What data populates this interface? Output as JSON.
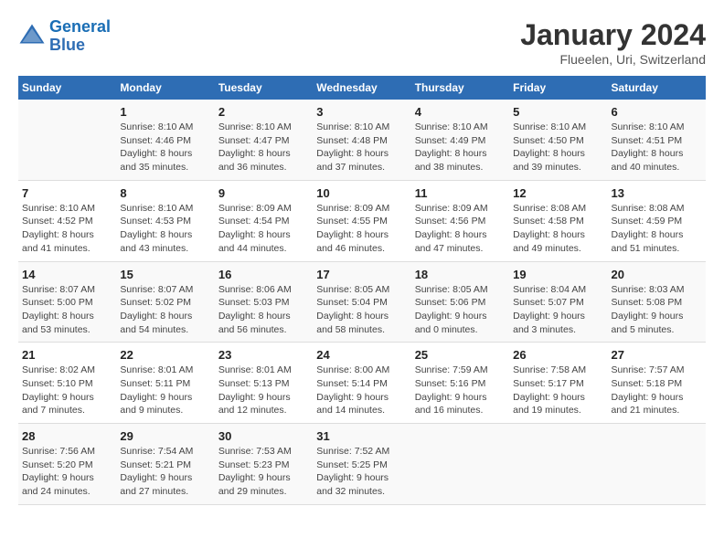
{
  "header": {
    "logo_line1": "General",
    "logo_line2": "Blue",
    "month": "January 2024",
    "location": "Flueelen, Uri, Switzerland"
  },
  "weekdays": [
    "Sunday",
    "Monday",
    "Tuesday",
    "Wednesday",
    "Thursday",
    "Friday",
    "Saturday"
  ],
  "weeks": [
    [
      {
        "day": "",
        "info": ""
      },
      {
        "day": "1",
        "info": "Sunrise: 8:10 AM\nSunset: 4:46 PM\nDaylight: 8 hours\nand 35 minutes."
      },
      {
        "day": "2",
        "info": "Sunrise: 8:10 AM\nSunset: 4:47 PM\nDaylight: 8 hours\nand 36 minutes."
      },
      {
        "day": "3",
        "info": "Sunrise: 8:10 AM\nSunset: 4:48 PM\nDaylight: 8 hours\nand 37 minutes."
      },
      {
        "day": "4",
        "info": "Sunrise: 8:10 AM\nSunset: 4:49 PM\nDaylight: 8 hours\nand 38 minutes."
      },
      {
        "day": "5",
        "info": "Sunrise: 8:10 AM\nSunset: 4:50 PM\nDaylight: 8 hours\nand 39 minutes."
      },
      {
        "day": "6",
        "info": "Sunrise: 8:10 AM\nSunset: 4:51 PM\nDaylight: 8 hours\nand 40 minutes."
      }
    ],
    [
      {
        "day": "7",
        "info": "Sunrise: 8:10 AM\nSunset: 4:52 PM\nDaylight: 8 hours\nand 41 minutes."
      },
      {
        "day": "8",
        "info": "Sunrise: 8:10 AM\nSunset: 4:53 PM\nDaylight: 8 hours\nand 43 minutes."
      },
      {
        "day": "9",
        "info": "Sunrise: 8:09 AM\nSunset: 4:54 PM\nDaylight: 8 hours\nand 44 minutes."
      },
      {
        "day": "10",
        "info": "Sunrise: 8:09 AM\nSunset: 4:55 PM\nDaylight: 8 hours\nand 46 minutes."
      },
      {
        "day": "11",
        "info": "Sunrise: 8:09 AM\nSunset: 4:56 PM\nDaylight: 8 hours\nand 47 minutes."
      },
      {
        "day": "12",
        "info": "Sunrise: 8:08 AM\nSunset: 4:58 PM\nDaylight: 8 hours\nand 49 minutes."
      },
      {
        "day": "13",
        "info": "Sunrise: 8:08 AM\nSunset: 4:59 PM\nDaylight: 8 hours\nand 51 minutes."
      }
    ],
    [
      {
        "day": "14",
        "info": "Sunrise: 8:07 AM\nSunset: 5:00 PM\nDaylight: 8 hours\nand 53 minutes."
      },
      {
        "day": "15",
        "info": "Sunrise: 8:07 AM\nSunset: 5:02 PM\nDaylight: 8 hours\nand 54 minutes."
      },
      {
        "day": "16",
        "info": "Sunrise: 8:06 AM\nSunset: 5:03 PM\nDaylight: 8 hours\nand 56 minutes."
      },
      {
        "day": "17",
        "info": "Sunrise: 8:05 AM\nSunset: 5:04 PM\nDaylight: 8 hours\nand 58 minutes."
      },
      {
        "day": "18",
        "info": "Sunrise: 8:05 AM\nSunset: 5:06 PM\nDaylight: 9 hours\nand 0 minutes."
      },
      {
        "day": "19",
        "info": "Sunrise: 8:04 AM\nSunset: 5:07 PM\nDaylight: 9 hours\nand 3 minutes."
      },
      {
        "day": "20",
        "info": "Sunrise: 8:03 AM\nSunset: 5:08 PM\nDaylight: 9 hours\nand 5 minutes."
      }
    ],
    [
      {
        "day": "21",
        "info": "Sunrise: 8:02 AM\nSunset: 5:10 PM\nDaylight: 9 hours\nand 7 minutes."
      },
      {
        "day": "22",
        "info": "Sunrise: 8:01 AM\nSunset: 5:11 PM\nDaylight: 9 hours\nand 9 minutes."
      },
      {
        "day": "23",
        "info": "Sunrise: 8:01 AM\nSunset: 5:13 PM\nDaylight: 9 hours\nand 12 minutes."
      },
      {
        "day": "24",
        "info": "Sunrise: 8:00 AM\nSunset: 5:14 PM\nDaylight: 9 hours\nand 14 minutes."
      },
      {
        "day": "25",
        "info": "Sunrise: 7:59 AM\nSunset: 5:16 PM\nDaylight: 9 hours\nand 16 minutes."
      },
      {
        "day": "26",
        "info": "Sunrise: 7:58 AM\nSunset: 5:17 PM\nDaylight: 9 hours\nand 19 minutes."
      },
      {
        "day": "27",
        "info": "Sunrise: 7:57 AM\nSunset: 5:18 PM\nDaylight: 9 hours\nand 21 minutes."
      }
    ],
    [
      {
        "day": "28",
        "info": "Sunrise: 7:56 AM\nSunset: 5:20 PM\nDaylight: 9 hours\nand 24 minutes."
      },
      {
        "day": "29",
        "info": "Sunrise: 7:54 AM\nSunset: 5:21 PM\nDaylight: 9 hours\nand 27 minutes."
      },
      {
        "day": "30",
        "info": "Sunrise: 7:53 AM\nSunset: 5:23 PM\nDaylight: 9 hours\nand 29 minutes."
      },
      {
        "day": "31",
        "info": "Sunrise: 7:52 AM\nSunset: 5:25 PM\nDaylight: 9 hours\nand 32 minutes."
      },
      {
        "day": "",
        "info": ""
      },
      {
        "day": "",
        "info": ""
      },
      {
        "day": "",
        "info": ""
      }
    ]
  ]
}
